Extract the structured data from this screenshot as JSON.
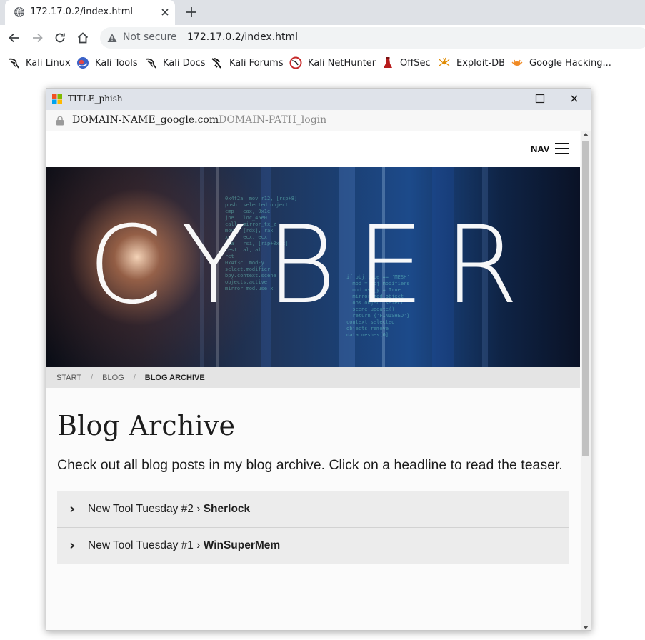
{
  "browser": {
    "tab_title": "172.17.0.2/index.html",
    "omnibox": {
      "security_label": "Not secure",
      "url": "172.17.0.2/index.html"
    },
    "bookmarks": [
      {
        "label": "Kali Linux",
        "icon": "kali-dragon-icon"
      },
      {
        "label": "Kali Tools",
        "icon": "kali-tools-icon"
      },
      {
        "label": "Kali Docs",
        "icon": "kali-dragon-icon"
      },
      {
        "label": "Kali Forums",
        "icon": "kali-forums-icon"
      },
      {
        "label": "Kali NetHunter",
        "icon": "nethunter-icon"
      },
      {
        "label": "OffSec",
        "icon": "offsec-icon"
      },
      {
        "label": "Exploit-DB",
        "icon": "exploit-db-icon"
      },
      {
        "label": "Google Hacking...",
        "icon": "ghdb-icon"
      }
    ]
  },
  "popup": {
    "title": "TITLE_phish",
    "address": {
      "domain": "DOMAIN-NAME_google.com",
      "path": "DOMAIN-PATH_login"
    }
  },
  "site": {
    "nav_label": "NAV",
    "hero_word": "CYBER",
    "breadcrumb": {
      "start": "START",
      "blog": "BLOG",
      "current": "BLOG ARCHIVE",
      "separator": "/"
    },
    "title": "Blog Archive",
    "intro": "Check out all blog posts in my blog archive. Click on a headline to read the teaser.",
    "posts": [
      {
        "prefix": "New Tool Tuesday #2 › ",
        "name": "Sherlock"
      },
      {
        "prefix": "New Tool Tuesday #1 › ",
        "name": "WinSuperMem"
      }
    ]
  },
  "colors": {
    "chrome_tabstrip": "#dee1e6",
    "popup_titlebar": "#dfe3ea",
    "breadcrumb_bg": "#e4e4e4",
    "accordion_bg": "#ececec"
  }
}
